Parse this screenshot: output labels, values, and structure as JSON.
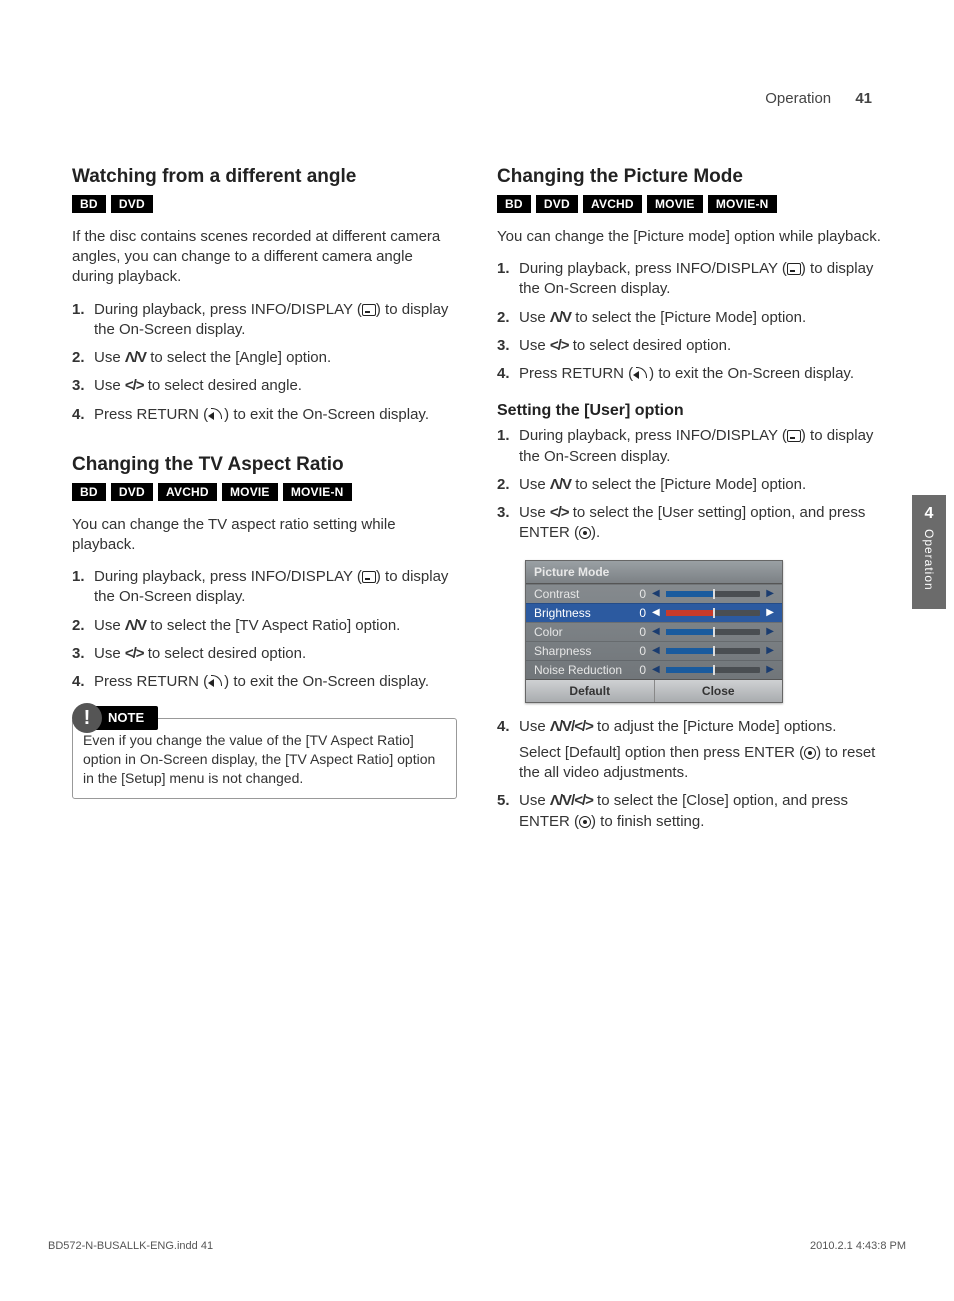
{
  "header": {
    "section": "Operation",
    "page": "41"
  },
  "sidebar": {
    "chapter": "4",
    "label": "Operation"
  },
  "left": {
    "sec1": {
      "title": "Watching from a different angle",
      "badges": [
        "BD",
        "DVD"
      ],
      "intro": "If the disc contains scenes recorded at different camera angles, you can change to a different camera angle during playback.",
      "steps": [
        {
          "n": "1.",
          "a": "During playback, press INFO/DISPLAY (",
          "b": ") to display the On-Screen display."
        },
        {
          "n": "2.",
          "a": "Use ",
          "sym": "Λ/V",
          "b": " to select the [Angle] option."
        },
        {
          "n": "3.",
          "a": "Use ",
          "sym": "</>",
          "b": " to select desired angle."
        },
        {
          "n": "4.",
          "a": "Press RETURN (",
          "b": ") to exit the On-Screen display."
        }
      ]
    },
    "sec2": {
      "title": "Changing the TV Aspect Ratio",
      "badges": [
        "BD",
        "DVD",
        "AVCHD",
        "MOVIE",
        "MOVIE-N"
      ],
      "intro": "You can change the TV aspect ratio setting while playback.",
      "steps": [
        {
          "n": "1.",
          "a": "During playback, press INFO/DISPLAY (",
          "b": ") to display the On-Screen display."
        },
        {
          "n": "2.",
          "a": "Use ",
          "sym": "Λ/V",
          "b": " to select the [TV Aspect Ratio] option."
        },
        {
          "n": "3.",
          "a": "Use ",
          "sym": "</>",
          "b": " to select desired option."
        },
        {
          "n": "4.",
          "a": "Press RETURN (",
          "b": ") to exit the On-Screen display."
        }
      ],
      "note_label": "NOTE",
      "note": "Even if you change the value of the [TV Aspect Ratio] option in On-Screen display, the [TV Aspect Ratio] option in the [Setup] menu is not changed."
    }
  },
  "right": {
    "sec1": {
      "title": "Changing the Picture Mode",
      "badges": [
        "BD",
        "DVD",
        "AVCHD",
        "MOVIE",
        "MOVIE-N"
      ],
      "intro": "You can change the [Picture mode] option while playback.",
      "steps": [
        {
          "n": "1.",
          "a": "During playback, press INFO/DISPLAY (",
          "b": ") to display the On-Screen display."
        },
        {
          "n": "2.",
          "a": "Use ",
          "sym": "Λ/V",
          "b": " to select the [Picture Mode] option."
        },
        {
          "n": "3.",
          "a": "Use ",
          "sym": "</>",
          "b": " to select desired option."
        },
        {
          "n": "4.",
          "a": "Press RETURN (",
          "b": ") to exit the On-Screen display."
        }
      ]
    },
    "sec2": {
      "title": "Setting the [User] option",
      "steps": [
        {
          "n": "1.",
          "a": "During playback, press INFO/DISPLAY (",
          "b": ") to display the On-Screen display."
        },
        {
          "n": "2.",
          "a": "Use ",
          "sym": "Λ/V",
          "b": " to select the [Picture Mode] option."
        },
        {
          "n": "3.",
          "a": "Use ",
          "sym": "</>",
          "b": " to select the [User setting] option, and press ENTER (",
          "c": ")."
        },
        {
          "n": "4.",
          "a": "Use ",
          "sym": "Λ/V/</>",
          "b": " to adjust the [Picture Mode] options.",
          "sub": "Select [Default] option then press ENTER (",
          "sub2": ") to reset the all video adjustments."
        },
        {
          "n": "5.",
          "a": "Use ",
          "sym": "Λ/V/</>",
          "b": " to select the [Close] option, and press ENTER (",
          "c": ") to finish setting."
        }
      ]
    },
    "osd": {
      "title": "Picture Mode",
      "rows": [
        {
          "label": "Contrast",
          "value": "0"
        },
        {
          "label": "Brightness",
          "value": "0",
          "active": true
        },
        {
          "label": "Color",
          "value": "0"
        },
        {
          "label": "Sharpness",
          "value": "0"
        },
        {
          "label": "Noise Reduction",
          "value": "0"
        }
      ],
      "foot1": "Default",
      "foot2": "Close"
    }
  },
  "footer": {
    "left": "BD572-N-BUSALLK-ENG.indd   41",
    "right": "2010.2.1   4:43:8 PM"
  }
}
